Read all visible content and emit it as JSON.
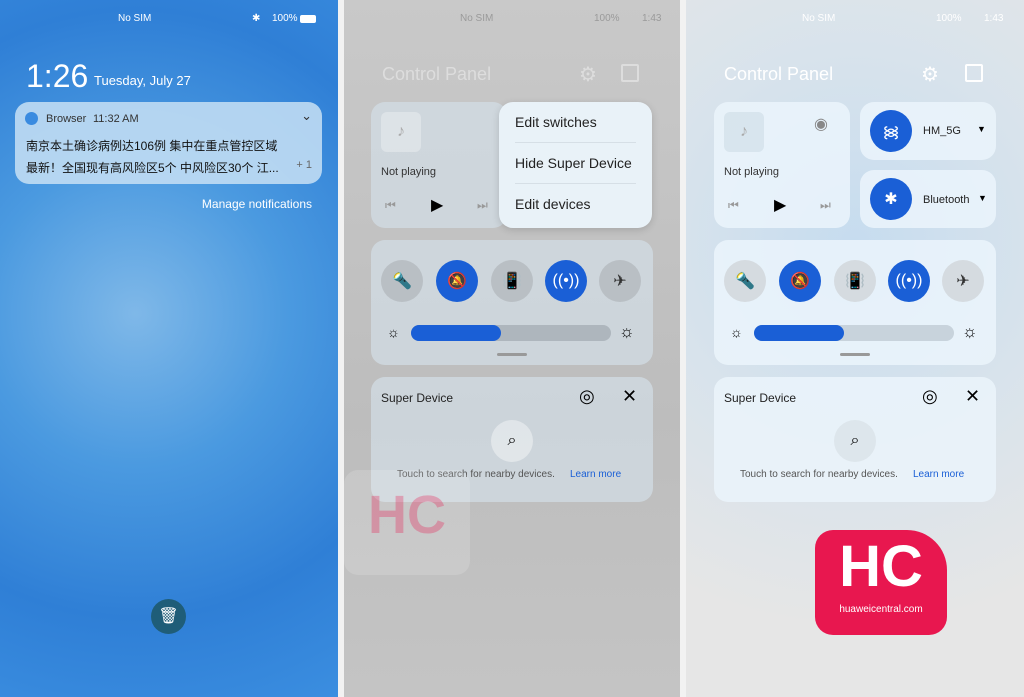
{
  "lockscreen": {
    "status_left": "No SIM",
    "status_right": "100%",
    "time": "1:26",
    "date": "Tuesday, July 27",
    "notification": {
      "app": "Browser",
      "time": "11:32 AM",
      "line1": "南京本土确诊病例达106例 集中在重点管控区域",
      "line2": "最新！全国现有高风险区5个 中风险区30个 江...",
      "more": "+ 1"
    },
    "manage": "Manage notifications"
  },
  "control": {
    "status_left": "No SIM",
    "status_right": "100%",
    "clock": "1:43",
    "title": "Control Panel",
    "not_playing": "Not playing",
    "wifi": "HM_5G",
    "bluetooth": "Bluetooth",
    "super_device": "Super Device",
    "search_hint": "Touch to search for nearby devices.",
    "learn_more": "Learn more",
    "brightness": 0.45
  },
  "menu": [
    "Edit switches",
    "Hide Super Device",
    "Edit devices"
  ],
  "watermark": {
    "logo": "HC",
    "site": "huaweicentral.com"
  },
  "colors": {
    "accent": "#1a5fd6",
    "logo": "#e8174f"
  }
}
